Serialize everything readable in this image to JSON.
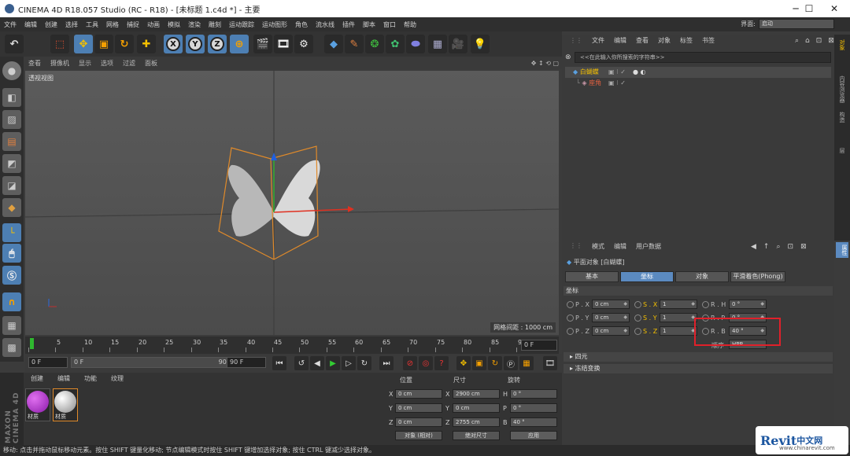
{
  "window": {
    "title": "CINEMA 4D R18.057 Studio (RC - R18) - [未标题 1.c4d *] - 主要",
    "minimize": "─",
    "maximize": "☐",
    "close": "✕"
  },
  "menubar": [
    "文件",
    "编辑",
    "创建",
    "选择",
    "工具",
    "网格",
    "捕捉",
    "动画",
    "模拟",
    "渲染",
    "雕刻",
    "运动跟踪",
    "运动图形",
    "角色",
    "流水线",
    "插件",
    "脚本",
    "窗口",
    "帮助"
  ],
  "interface": {
    "label": "界面:",
    "value": "启动"
  },
  "toolbar": {
    "axis_x": "X",
    "axis_y": "Y",
    "axis_z": "Z"
  },
  "viewport": {
    "menu": [
      "查看",
      "摄像机",
      "显示",
      "选项",
      "过滤",
      "面板"
    ],
    "label": "透视视图",
    "grid_spacing": "网格间距 : 1000 cm",
    "nav_icons": "✥ ↕ ⟲ ▢"
  },
  "timeline": {
    "ticks": [
      "0",
      "5",
      "10",
      "15",
      "20",
      "25",
      "30",
      "35",
      "40",
      "45",
      "50",
      "55",
      "60",
      "65",
      "70",
      "75",
      "80",
      "85",
      "90"
    ],
    "frame_field": "0 F"
  },
  "playback": {
    "start": "0 F",
    "current": "0 F",
    "end_slider": "90 F",
    "end": "90 F"
  },
  "materials": {
    "menu": [
      "创建",
      "编辑",
      "功能",
      "纹理"
    ],
    "items": [
      {
        "label": "材质",
        "color": "#b23bd0"
      },
      {
        "label": "材质",
        "color": "#dcdcdc"
      }
    ]
  },
  "brand": "MAXON CINEMA 4D",
  "coords": {
    "headers": [
      "位置",
      "尺寸",
      "旋转"
    ],
    "rows": [
      {
        "a": "X",
        "pos": "0 cm",
        "b": "X",
        "size": "2900 cm",
        "c": "H",
        "rot": "0 °"
      },
      {
        "a": "Y",
        "pos": "0 cm",
        "b": "Y",
        "size": "0 cm",
        "c": "P",
        "rot": "0 °"
      },
      {
        "a": "Z",
        "pos": "0 cm",
        "b": "Z",
        "size": "2755 cm",
        "c": "B",
        "rot": "40 °"
      }
    ],
    "mode1": "对象 (相对)",
    "mode2": "绝对尺寸",
    "apply": "应用"
  },
  "status": "移动: 点击并拖动鼠标移动元素。按住 SHIFT 键量化移动; 节点编辑模式时按住 SHIFT 键增加选择对象; 按住 CTRL 键减少选择对象。",
  "objects": {
    "menu": [
      "文件",
      "编辑",
      "查看",
      "对象",
      "标签",
      "书签"
    ],
    "search": "<<在此输入你所搜索的字符串>>",
    "rows": [
      {
        "name": "白蝴蝶"
      },
      {
        "name": "座角"
      }
    ]
  },
  "right_tabs": [
    "对象",
    "内容浏览器",
    "构造",
    "层"
  ],
  "attributes": {
    "menu": [
      "模式",
      "编辑",
      "用户数据"
    ],
    "title": "平面对象 [白蝴蝶]",
    "tabs": [
      "基本",
      "坐标",
      "对象",
      "平滑着色(Phong)"
    ],
    "section": "坐标",
    "rows": [
      {
        "p": "P . X",
        "pv": "0 cm",
        "s": "S . X",
        "sv": "1",
        "r": "R . H",
        "rv": "0 °"
      },
      {
        "p": "P . Y",
        "pv": "0 cm",
        "s": "S . Y",
        "sv": "1",
        "r": "R . P",
        "rv": "0 °"
      },
      {
        "p": "P . Z",
        "pv": "0 cm",
        "s": "S . Z",
        "sv": "1",
        "r": "R . B",
        "rv": "40 °"
      }
    ],
    "order_label": "顺序",
    "order_value": "HPB",
    "folds": [
      "四元",
      "冻结变换"
    ]
  },
  "watermark": {
    "brand": "Revit",
    "cn": "中文网",
    "url": "www.chinarevit.com"
  },
  "colors": {
    "accent": "#5b8ac0",
    "highlight": "#e0202a",
    "cage": "#e08a2a"
  }
}
